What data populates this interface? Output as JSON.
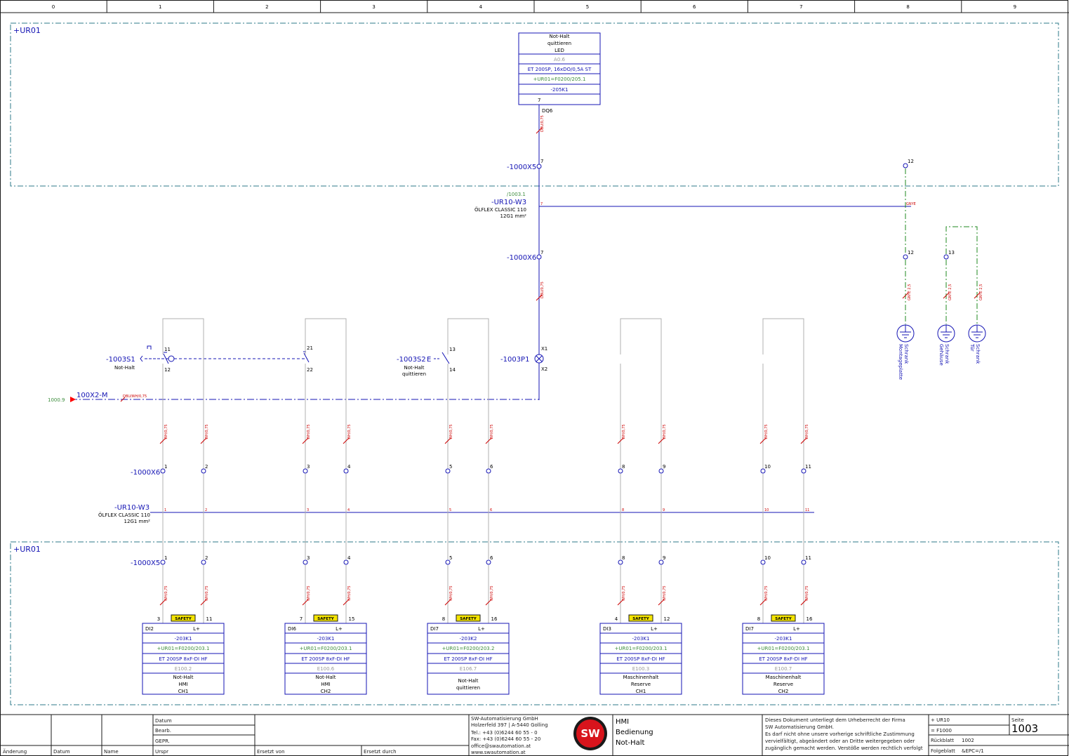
{
  "sheet": {
    "columns": [
      "0",
      "1",
      "2",
      "3",
      "4",
      "5",
      "6",
      "7",
      "8",
      "9"
    ],
    "location_top": "+UR01",
    "location_bottom": "+UR01"
  },
  "colors": {
    "frame": "#1a1a1a",
    "wire": "#1414b4",
    "tag": "#1414b4",
    "terminal_label": "#000000",
    "wire_label": "#cc0000",
    "location_box": "#2c7a8a",
    "pe_wire": "#1f8a1f",
    "crossref": "#3c8c3c",
    "safety_badge": "#f4e400",
    "plc_module": "#1414b4"
  },
  "top_module": {
    "desc_line1": "Not-Halt",
    "desc_line2": "quittieren",
    "desc_line3": "LED",
    "address": "A0.6",
    "type": "ET 200SP, 16xDO/0,5A ST",
    "location": "+UR01=F0200/205.1",
    "tag": "-205K1",
    "pin": "7",
    "channel": "DQ6"
  },
  "terminals": {
    "x5_top": {
      "tag": "-1000X5",
      "pin": "7"
    },
    "x6_mid": {
      "tag": "-1000X6",
      "pin": "7"
    },
    "x6_low": {
      "tag": "-1000X6",
      "pins": [
        "1",
        "2",
        "3",
        "4",
        "5",
        "6",
        "8",
        "9",
        "10",
        "11"
      ]
    },
    "x5_low": {
      "tag": "-1000X5",
      "pins": [
        "1",
        "2",
        "3",
        "4",
        "5",
        "6",
        "8",
        "9",
        "10",
        "11"
      ]
    }
  },
  "cable_top": {
    "crossref": "/1003.1",
    "tag": "-UR10-W3",
    "type": "ÖLFLEX CLASSIC 110",
    "size": "12G1 mm²",
    "core": "7",
    "pe_core": "GNYE"
  },
  "cable_bottom": {
    "tag": "-UR10-W3",
    "type": "ÖLFLEX CLASSIC 110",
    "size": "12G1 mm²",
    "cores": [
      "1",
      "2",
      "3",
      "4",
      "5",
      "6",
      "8",
      "9",
      "10",
      "11"
    ]
  },
  "wire_labels": {
    "dq6": "DBU/0,75",
    "lamp": "DBU/0,75",
    "wh": "WH/0,75",
    "m_line": "DBU/WH/0,75",
    "pe": "GNYE 2,5"
  },
  "devices": {
    "s1": {
      "tag": "-1003S1",
      "desc": "Not-Halt",
      "pins_a": [
        "11",
        "12"
      ],
      "pins_b": [
        "21",
        "22"
      ]
    },
    "s2": {
      "tag": "-1003S2",
      "desc_line1": "Not-Halt",
      "desc_line2": "quittieren",
      "pins": [
        "13",
        "14"
      ],
      "suffix": "E"
    },
    "p1": {
      "tag": "-1003P1",
      "pins": [
        "X1",
        "X2"
      ]
    }
  },
  "reference_m": {
    "crossref": "1000.9",
    "tag": "100X2-M"
  },
  "pe_terminals": [
    {
      "pin": "12",
      "upper_pin": "12",
      "label_line1": "Schrank",
      "label_line2": "Montageplatte"
    },
    {
      "pin": "13",
      "label_line1": "Schrank",
      "label_line2": "Gehäuse"
    },
    {
      "label_line1": "Schrank",
      "label_line2": "Tür"
    }
  ],
  "modules": [
    {
      "di": "DI2",
      "pin_l": "3",
      "pin_r": "11",
      "lplus": "L+",
      "badge": "SAFETY",
      "tag": "-203K1",
      "location": "+UR01=F0200/203.1",
      "type": "ET 200SP 8xF-DI HF",
      "address": "E100.2",
      "desc": [
        "Not-Halt",
        "HMI",
        "CH1"
      ]
    },
    {
      "di": "DI6",
      "pin_l": "7",
      "pin_r": "15",
      "lplus": "L+",
      "badge": "SAFETY",
      "tag": "-203K1",
      "location": "+UR01=F0200/203.1",
      "type": "ET 200SP 8xF-DI HF",
      "address": "E100.6",
      "desc": [
        "Not-Halt",
        "HMI",
        "CH2"
      ]
    },
    {
      "di": "DI7",
      "pin_l": "8",
      "pin_r": "16",
      "lplus": "L+",
      "badge": "SAFETY",
      "tag": "-203K2",
      "location": "+UR01=F0200/203.2",
      "type": "ET 200SP 8xF-DI HF",
      "address": "E106.7",
      "desc": [
        "Not-Halt",
        "quittieren",
        ""
      ]
    },
    {
      "di": "DI3",
      "pin_l": "4",
      "pin_r": "12",
      "lplus": "L+",
      "badge": "SAFETY",
      "tag": "-203K1",
      "location": "+UR01=F0200/203.1",
      "type": "ET 200SP 8xF-DI HF",
      "address": "E100.3",
      "desc": [
        "Maschinenhalt",
        "Reserve",
        "CH1"
      ]
    },
    {
      "di": "DI7",
      "pin_l": "8",
      "pin_r": "16",
      "lplus": "L+",
      "badge": "SAFETY",
      "tag": "-203K1",
      "location": "+UR01=F0200/203.1",
      "type": "ET 200SP 8xF-DI HF",
      "address": "E100.7",
      "desc": [
        "Maschinenhalt",
        "Reserve",
        "CH2"
      ]
    }
  ],
  "title_block": {
    "labels": {
      "datum": "Datum",
      "bearb": "Bearb.",
      "gepr": "GEPR.",
      "aenderung": "Änderung",
      "datum2": "Datum",
      "name": "Name",
      "urspr": "Urspr",
      "ersetzt_von": "Ersetzt von",
      "ersetzt_durch": "Ersetzt durch"
    },
    "company": [
      "SW-Automatisierung GmbH",
      "Holzerfeld 397 | A-5440 Golling",
      "Tel.: +43 (0)6244 60 55 - 0",
      "Fax: +43 (0)6244 60 55 - 20",
      "office@swautomation.at",
      "www.swautomation.at"
    ],
    "logo_text": "SW",
    "title": [
      "HMI",
      "Bedienung",
      "Not-Halt"
    ],
    "copyright": [
      "Dieses Dokument unterliegt dem Urheberrecht der Firma",
      "SW Automatisierung GmbH.",
      "Es darf nicht ohne unsere vorherige schriftliche Zustimmung",
      "vervielfältigt, abgeändert oder an Dritte weitergegeben oder",
      "zugänglich gemacht werden. Verstöße werden rechtlich verfolgt"
    ],
    "plant": "+ UR10",
    "function": "= F1000",
    "seite_label": "Seite",
    "seite": "1003",
    "rueckblatt_label": "Rückblatt",
    "rueckblatt": "1002",
    "folgeblatt_label": "Folgeblatt",
    "folgeblatt": "&EPC=/1"
  }
}
